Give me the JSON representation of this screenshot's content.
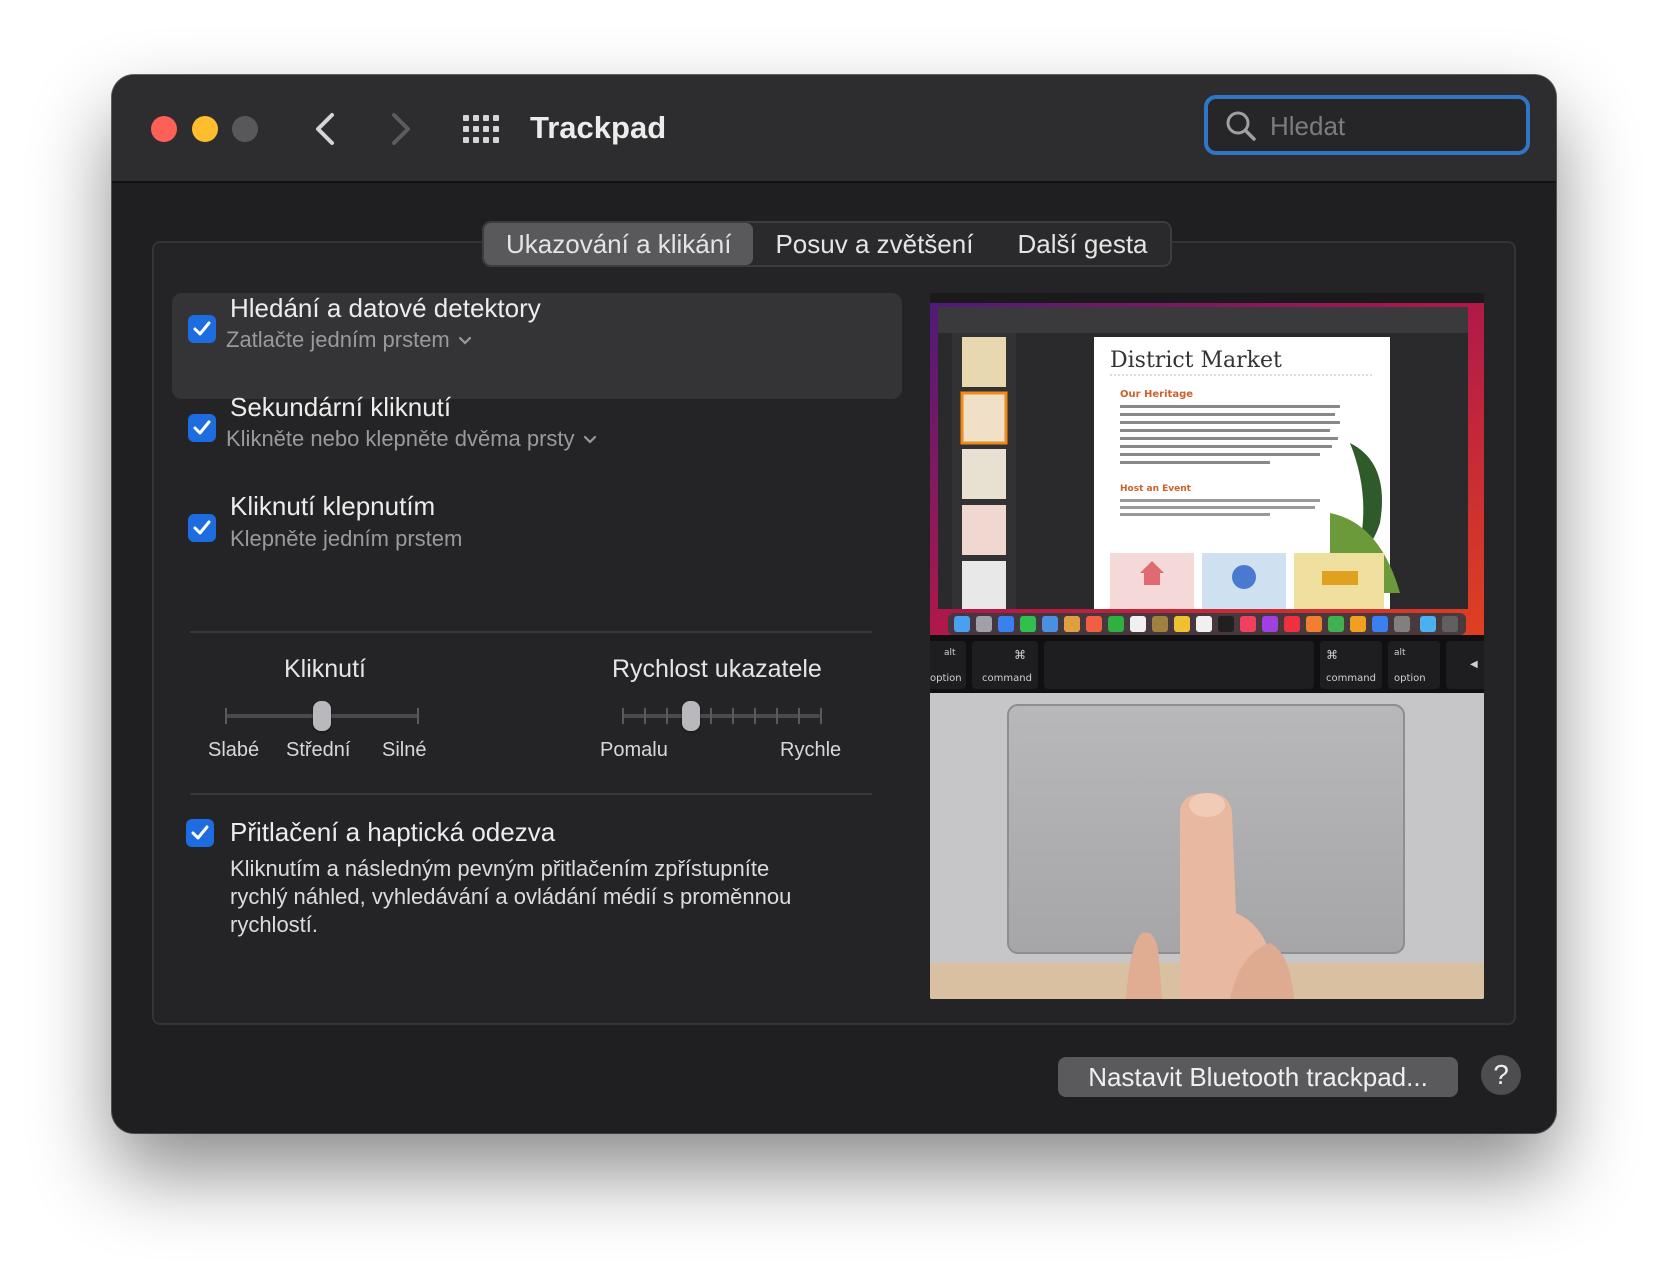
{
  "window": {
    "title": "Trackpad",
    "search_placeholder": "Hledat"
  },
  "tabs": [
    {
      "label": "Ukazování a klikání",
      "active": true
    },
    {
      "label": "Posuv a zvětšení",
      "active": false
    },
    {
      "label": "Další gesta",
      "active": false
    }
  ],
  "options": [
    {
      "title": "Hledání a datové detektory",
      "subtitle": "Zatlačte jedním prstem",
      "checked": true,
      "has_dropdown": true
    },
    {
      "title": "Sekundární kliknutí",
      "subtitle": "Klikněte nebo klepněte dvěma prsty",
      "checked": true,
      "has_dropdown": true
    },
    {
      "title": "Kliknutí klepnutím",
      "subtitle": "Klepněte jedním prstem",
      "checked": true,
      "has_dropdown": false
    }
  ],
  "click_slider": {
    "label": "Kliknutí",
    "min_label": "Slabé",
    "mid_label": "Střední",
    "max_label": "Silné",
    "value": 0.5
  },
  "speed_slider": {
    "label": "Rychlost ukazatele",
    "min_label": "Pomalu",
    "max_label": "Rychle",
    "value": 0.35
  },
  "force_touch": {
    "title": "Přitlačení a haptická odezva",
    "checked": true,
    "description": "Kliknutím a následným pevným přitlačením zpřístupníte rychlý náhled, vyhledávání a ovládání médií s proměnnou rychlostí."
  },
  "preview": {
    "doc_title": "District Market",
    "section1": "Our Heritage",
    "section2": "Host an Event",
    "key_alt": "alt",
    "key_option": "option",
    "key_command": "command",
    "key_cmd_symbol": "⌘"
  },
  "footer": {
    "bluetooth_button": "Nastavit Bluetooth trackpad...",
    "help_label": "?"
  },
  "colors": {
    "accent": "#1d6ce0",
    "search_focus": "#2f77c5",
    "close": "#fe5f57",
    "minimize": "#febc2e"
  }
}
